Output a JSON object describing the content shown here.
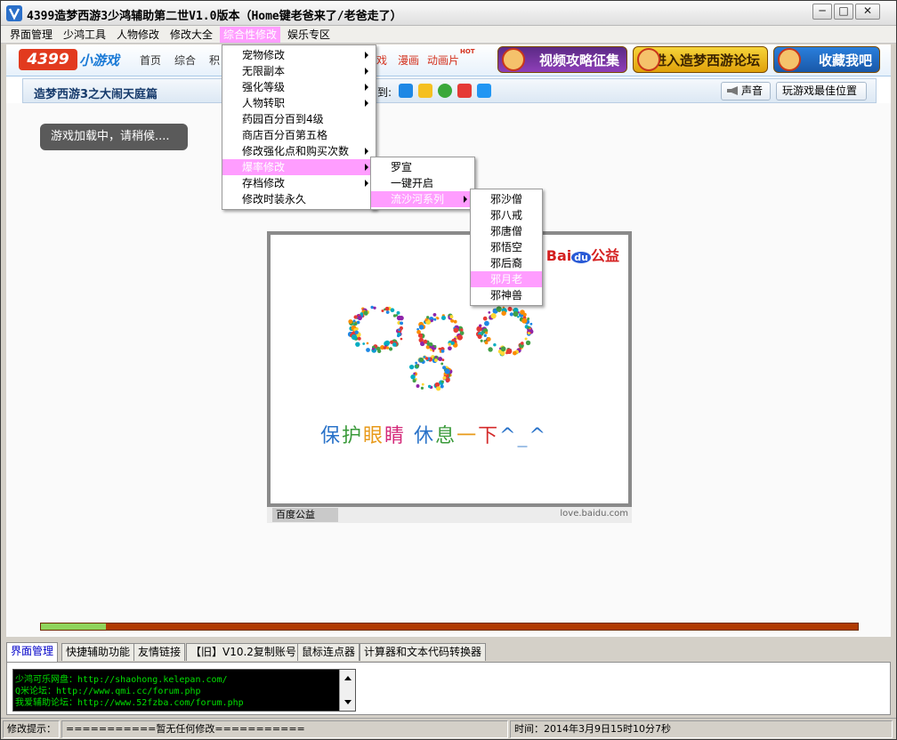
{
  "window": {
    "title": "4399造梦西游3少鸿辅助第二世V1.0版本（Home键老爸来了/老爸走了）",
    "minimize": "─",
    "maximize": "□",
    "close": "✕"
  },
  "menubar": [
    "界面管理",
    "少鸿工具",
    "人物修改",
    "修改大全",
    "综合性修改",
    "娱乐专区"
  ],
  "site": {
    "logo_main": "4399",
    "logo_sub": "小游戏",
    "nav": [
      "首页",
      "综合",
      "积",
      "戏",
      "漫画",
      "动画片"
    ],
    "hot": "HOT",
    "banners": [
      "视频攻略征集",
      "进入造梦西游论坛",
      "收藏我吧"
    ]
  },
  "gamebar": {
    "title": "造梦西游3之大闹天庭篇",
    "share_label": "到:",
    "sound": "声音",
    "best_position": "玩游戏最佳位置"
  },
  "loading": "游戏加载中，请稍候....",
  "baidu_ad": {
    "logo": "Bai",
    "logo_du": "du",
    "logo_suffix": "公益",
    "slogan_parts": [
      "保",
      "护",
      "眼",
      "睛",
      " 休",
      "息",
      "一",
      "下",
      "^_^"
    ],
    "footer_left": "百度公益",
    "footer_right": "love.baidu.com",
    "colors": [
      "#2a73c9",
      "#3a9a3a",
      "#e89a1a",
      "#d42a7a",
      "#2a73c9",
      "#3a9a3a",
      "#e89a1a",
      "#d42a2a",
      "#2a73c9"
    ]
  },
  "progress": {
    "fraction": 0.08
  },
  "menu_main": {
    "items": [
      {
        "label": "宠物修改",
        "submenu": true
      },
      {
        "label": "无限副本",
        "submenu": true
      },
      {
        "label": "强化等级",
        "submenu": true
      },
      {
        "label": "人物转职",
        "submenu": true
      },
      {
        "label": "药园百分百到4级",
        "submenu": false
      },
      {
        "label": "商店百分百第五格",
        "submenu": false
      },
      {
        "label": "修改强化点和购买次数",
        "submenu": true
      },
      {
        "label": "爆率修改",
        "submenu": true,
        "highlight": true
      },
      {
        "label": "存档修改",
        "submenu": true
      },
      {
        "label": "修改时装永久",
        "submenu": false
      }
    ]
  },
  "menu_sub1": {
    "items": [
      {
        "label": "罗宣",
        "submenu": false
      },
      {
        "label": "一键开启",
        "submenu": false
      },
      {
        "label": "流沙河系列",
        "submenu": true,
        "highlight": true
      }
    ]
  },
  "menu_sub2": {
    "items": [
      {
        "label": "邪沙僧"
      },
      {
        "label": "邪八戒"
      },
      {
        "label": "邪唐僧"
      },
      {
        "label": "邪悟空"
      },
      {
        "label": "邪后裔"
      },
      {
        "label": "邪月老",
        "highlight": true
      },
      {
        "label": "邪神兽"
      }
    ]
  },
  "tabs": [
    "界面管理",
    "快捷辅助功能",
    "友情链接",
    "【旧】V10.2复制账号",
    "鼠标连点器",
    "计算器和文本代码转换器"
  ],
  "info_lines": [
    "少鸿可乐网盘：http://shaohong.kelepan.com/",
    "Q米论坛：http://www.qmi.cc/forum.php",
    "我爱辅助论坛：http://www.52fzba.com/forum.php"
  ],
  "status": {
    "label": "修改提示：",
    "message": "===========暂无任何修改===========",
    "time": "时间：2014年3月9日15时10分7秒"
  },
  "colors": {
    "menu_highlight": "#ff9dff",
    "progress_fill": "#8fd35a",
    "progress_track": "#b03a00",
    "info_text": "#00e000"
  }
}
